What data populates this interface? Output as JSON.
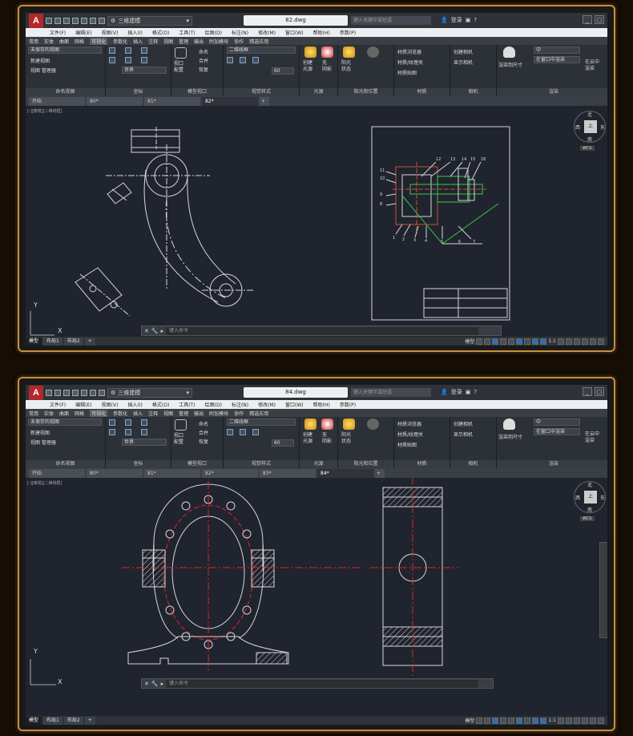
{
  "screens": [
    {
      "file_title": "82.dwg",
      "workspace": "三维建模",
      "search_placeholder": "键入关键字或短语",
      "signin": "登录",
      "app_letter": "A",
      "menu": [
        "文件(F)",
        "编辑(E)",
        "视图(V)",
        "插入(I)",
        "格式(O)",
        "工具(T)",
        "绘图(D)",
        "标注(N)",
        "修改(M)",
        "窗口(W)",
        "帮助(H)",
        "参数(P)"
      ],
      "ribbon_tabs": [
        "常用",
        "实体",
        "曲面",
        "网格",
        "可视化",
        "参数化",
        "插入",
        "注释",
        "视图",
        "管理",
        "输出",
        "附加模块",
        "协作",
        "精选应用"
      ],
      "active_ribbon_tab": "可视化",
      "named_views": {
        "dropdown": "未保存的视图",
        "new": "新建视图",
        "manager": "视图 管理器",
        "label": "命名视图"
      },
      "coords": {
        "world": "世界",
        "label": "坐标"
      },
      "viewports": {
        "config": "视口\n配置",
        "named": "命名",
        "merge": "合并",
        "restore": "恢复",
        "label": "模型视口"
      },
      "visual_styles": {
        "style": "二维线框",
        "value": "60",
        "label": "视觉样式"
      },
      "lights": {
        "create": "创建\n光源",
        "noshadow": "无\n阴影",
        "label": "光源"
      },
      "sun": {
        "state": "阳光\n状态",
        "label": "阳光和位置"
      },
      "materials": {
        "browser": "材质浏览器",
        "mapping": "材质/纹理关",
        "map": "材质贴图",
        "label": "材质"
      },
      "camera": {
        "create": "创建相机",
        "show": "显示相机",
        "label": "相机"
      },
      "render": {
        "to_size": "渲染到尺寸",
        "quality": "中",
        "in_window": "在窗口中渲染",
        "cloud": "在云中\n渲染",
        "label": "渲染"
      },
      "doc_tabs": [
        "开始",
        "80*",
        "81*",
        "82*"
      ],
      "active_doc_tab": "82*",
      "viewport_label": "[-][俯视][二维线框]",
      "compass": {
        "n": "北",
        "s": "南",
        "w": "西",
        "e": "东",
        "top": "上",
        "wcs": "WCS"
      },
      "ucs": {
        "x": "X",
        "y": "Y"
      },
      "cmd_placeholder": "键入命令",
      "layout_tabs": [
        "模型",
        "布局1",
        "布局2"
      ],
      "status_model": "模型",
      "scale": "1:1",
      "balloon_labels": [
        "12",
        "13",
        "14",
        "15",
        "16",
        "11",
        "10",
        "9",
        "8",
        "1",
        "2",
        "3",
        "4",
        "5",
        "6",
        "7"
      ]
    },
    {
      "file_title": "84.dwg",
      "workspace": "三维建模",
      "search_placeholder": "键入关键字或短语",
      "signin": "登录",
      "app_letter": "A",
      "menu": [
        "文件(F)",
        "编辑(E)",
        "视图(V)",
        "插入(I)",
        "格式(O)",
        "工具(T)",
        "绘图(D)",
        "标注(N)",
        "修改(M)",
        "窗口(W)",
        "帮助(H)",
        "参数(P)"
      ],
      "ribbon_tabs": [
        "常用",
        "实体",
        "曲面",
        "网格",
        "可视化",
        "参数化",
        "插入",
        "注释",
        "视图",
        "管理",
        "输出",
        "附加模块",
        "协作",
        "精选应用"
      ],
      "active_ribbon_tab": "可视化",
      "named_views": {
        "dropdown": "未保存的视图",
        "new": "新建视图",
        "manager": "视图 管理器",
        "label": "命名视图"
      },
      "coords": {
        "world": "世界",
        "label": "坐标"
      },
      "viewports": {
        "config": "视口\n配置",
        "named": "命名",
        "merge": "合并",
        "restore": "恢复",
        "label": "模型视口"
      },
      "visual_styles": {
        "style": "二维线框",
        "value": "60",
        "label": "视觉样式"
      },
      "lights": {
        "create": "创建\n光源",
        "noshadow": "无\n阴影",
        "label": "光源"
      },
      "sun": {
        "state": "阳光\n状态",
        "label": "阳光和位置"
      },
      "materials": {
        "browser": "材质浏览器",
        "mapping": "材质/纹理关",
        "map": "材质贴图",
        "label": "材质"
      },
      "camera": {
        "create": "创建相机",
        "show": "显示相机",
        "label": "相机"
      },
      "render": {
        "to_size": "渲染到尺寸",
        "quality": "中",
        "in_window": "在窗口中渲染",
        "cloud": "在云中\n渲染",
        "label": "渲染"
      },
      "doc_tabs": [
        "开始",
        "80*",
        "81*",
        "82*",
        "83*",
        "84*"
      ],
      "active_doc_tab": "84*",
      "viewport_label": "[-][俯视][二维线框]",
      "compass": {
        "n": "北",
        "s": "南",
        "w": "西",
        "e": "东",
        "top": "上",
        "wcs": "WCS"
      },
      "ucs": {
        "x": "X",
        "y": "Y"
      },
      "cmd_placeholder": "键入命令",
      "layout_tabs": [
        "模型",
        "布局1",
        "布局2"
      ],
      "status_model": "模型",
      "scale": "1:1"
    }
  ],
  "colors": {
    "frame": "#c8923a",
    "canvas": "#20242e",
    "centerline": "#e0242a",
    "hatch": "#d0d0d0",
    "accent": "#2d6fb6"
  }
}
